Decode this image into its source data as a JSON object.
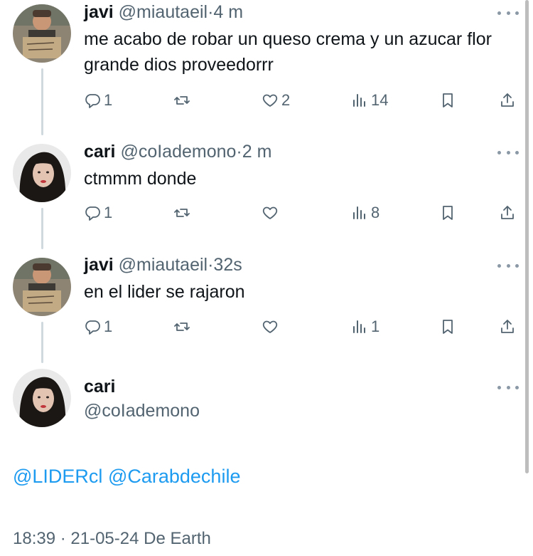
{
  "tweets": [
    {
      "name": "javi",
      "handle": "@miautaeil",
      "sep": "·",
      "time": "4 m",
      "text": "me acabo de robar un queso crema y un azucar flor grande dios proveedorrr",
      "avatar": "avatar-javi",
      "replies": "1",
      "retweets": "",
      "likes": "2",
      "views": "14"
    },
    {
      "name": "cari",
      "handle": "@coIademono",
      "sep": "·",
      "time": "2 m",
      "text": "ctmmm donde",
      "avatar": "avatar-cari",
      "replies": "1",
      "retweets": "",
      "likes": "",
      "views": "8"
    },
    {
      "name": "javi",
      "handle": "@miautaeil",
      "sep": "·",
      "time": "32s",
      "text": "en el lider se rajaron",
      "avatar": "avatar-javi",
      "replies": "1",
      "retweets": "",
      "likes": "",
      "views": "1"
    }
  ],
  "main": {
    "name": "cari",
    "handle": "@coIademono",
    "mentions": [
      "@LIDERcl",
      "@Carabdechile"
    ],
    "footer": "18:39 · 21-05-24 De Earth"
  },
  "icons": {
    "reply": "reply-icon",
    "retweet": "retweet-icon",
    "like": "heart-icon",
    "views": "views-icon",
    "bookmark": "bookmark-icon",
    "share": "share-icon",
    "more": "more-icon"
  },
  "colors": {
    "text": "#0f1419",
    "secondary": "#536471",
    "link": "#1d9bf0",
    "thread_line": "#cfd9de"
  }
}
